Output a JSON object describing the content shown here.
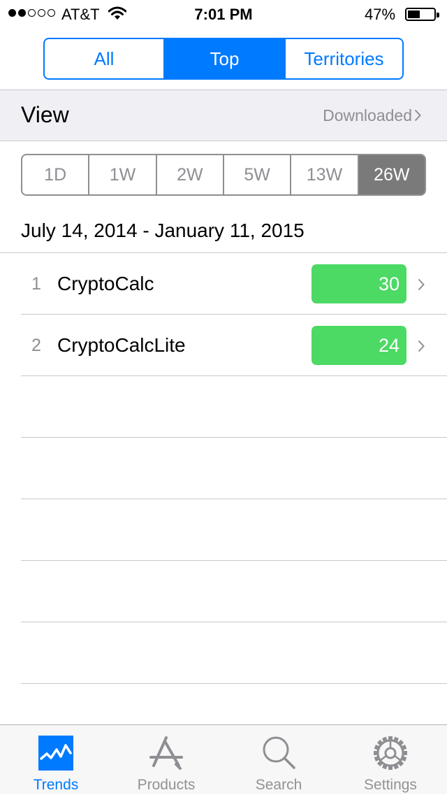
{
  "status_bar": {
    "carrier": "AT&T",
    "time": "7:01 PM",
    "battery_percent": "47%",
    "battery_level": 0.47,
    "signal_bars_filled": 2,
    "signal_bars_total": 5
  },
  "top_segments": {
    "items": [
      {
        "label": "All",
        "active": false
      },
      {
        "label": "Top",
        "active": true
      },
      {
        "label": "Territories",
        "active": false
      }
    ]
  },
  "view_row": {
    "label": "View",
    "value": "Downloaded"
  },
  "period_segments": {
    "items": [
      {
        "label": "1D",
        "active": false
      },
      {
        "label": "1W",
        "active": false
      },
      {
        "label": "2W",
        "active": false
      },
      {
        "label": "5W",
        "active": false
      },
      {
        "label": "13W",
        "active": false
      },
      {
        "label": "26W",
        "active": true
      }
    ]
  },
  "date_range": "July 14, 2014 - January 11, 2015",
  "rankings": [
    {
      "rank": "1",
      "name": "CryptoCalc",
      "count": "30"
    },
    {
      "rank": "2",
      "name": "CryptoCalcLite",
      "count": "24"
    }
  ],
  "tab_bar": {
    "items": [
      {
        "label": "Trends",
        "icon": "trends-icon",
        "active": true
      },
      {
        "label": "Products",
        "icon": "app-store-icon",
        "active": false
      },
      {
        "label": "Search",
        "icon": "search-icon",
        "active": false
      },
      {
        "label": "Settings",
        "icon": "gear-icon",
        "active": false
      }
    ]
  },
  "colors": {
    "accent": "#007aff",
    "badge_green": "#4cd964",
    "selected_period": "#7a7a7a",
    "secondary_text": "#8e8e93"
  }
}
